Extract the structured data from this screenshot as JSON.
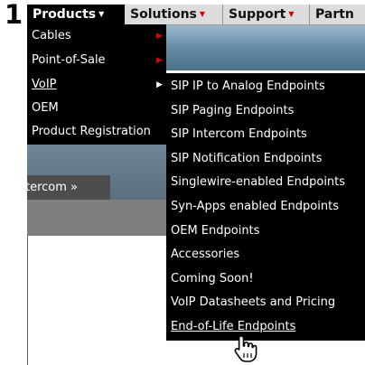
{
  "step": {
    "number": "1"
  },
  "nav": {
    "items": [
      {
        "label": "Products",
        "active": true
      },
      {
        "label": "Solutions",
        "active": false
      },
      {
        "label": "Support",
        "active": false
      },
      {
        "label": "Partn",
        "active": false
      }
    ]
  },
  "products_menu": {
    "items": [
      {
        "label": "Cables",
        "has_submenu": true
      },
      {
        "label": "Point-of-Sale",
        "has_submenu": true
      },
      {
        "label": "VoIP",
        "has_submenu": true,
        "hovered": true
      },
      {
        "label": "OEM",
        "has_submenu": false
      },
      {
        "label": "Product Registration",
        "has_submenu": false
      }
    ]
  },
  "voip_submenu": {
    "items": [
      {
        "label": "SIP IP to Analog Endpoints"
      },
      {
        "label": "SIP Paging Endpoints"
      },
      {
        "label": "SIP Intercom Endpoints"
      },
      {
        "label": "SIP Notification Endpoints"
      },
      {
        "label": "Singlewire-enabled Endpoints"
      },
      {
        "label": "Syn-Apps enabled Endpoints"
      },
      {
        "label": "OEM Endpoints"
      },
      {
        "label": "Accessories"
      },
      {
        "label": "Coming Soon!"
      },
      {
        "label": "VoIP Datasheets and Pricing"
      },
      {
        "label": "End-of-Life Endpoints",
        "hovered": true
      }
    ]
  },
  "background": {
    "intercom_link": "tercom »"
  },
  "colors": {
    "menu_bg": "#000000",
    "nav_bg": "#dcdcdc",
    "arrow_red": "#e00000"
  },
  "cursor": {
    "icon": "hand-pointer-icon"
  }
}
